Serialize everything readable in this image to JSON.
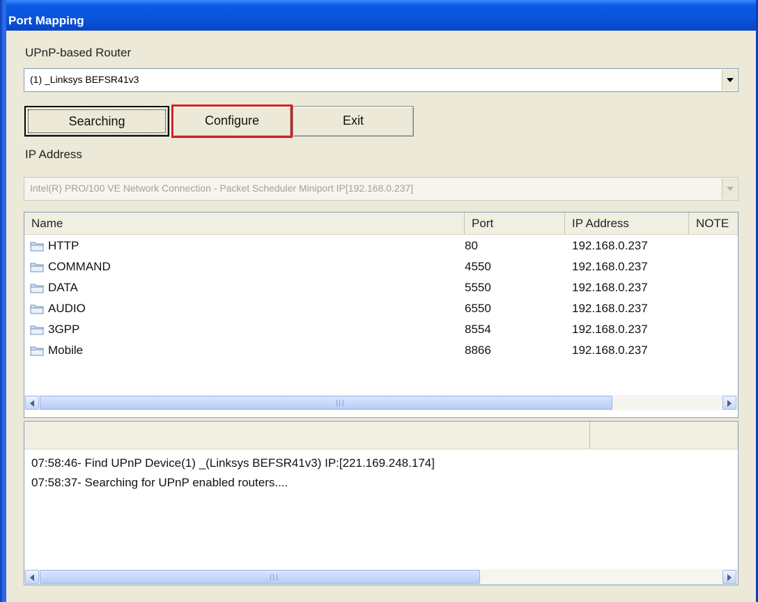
{
  "window": {
    "title": "Port Mapping"
  },
  "router": {
    "label": "UPnP-based Router",
    "selected": "(1) _Linksys BEFSR41v3"
  },
  "buttons": {
    "searching": "Searching",
    "configure": "Configure",
    "exit": "Exit"
  },
  "ip": {
    "label": "IP Address",
    "selected": "Intel(R) PRO/100 VE Network Connection - Packet Scheduler Miniport  IP[192.168.0.237]"
  },
  "mapping_table": {
    "columns": [
      "Name",
      "Port",
      "IP Address",
      "NOTE"
    ],
    "rows": [
      {
        "name": "HTTP",
        "port": "80",
        "ip": "192.168.0.237",
        "icon": "folder-icon"
      },
      {
        "name": "COMMAND",
        "port": "4550",
        "ip": "192.168.0.237",
        "icon": "folder-icon"
      },
      {
        "name": "DATA",
        "port": "5550",
        "ip": "192.168.0.237",
        "icon": "folder-icon"
      },
      {
        "name": "AUDIO",
        "port": "6550",
        "ip": "192.168.0.237",
        "icon": "folder-icon"
      },
      {
        "name": "3GPP",
        "port": "8554",
        "ip": "192.168.0.237",
        "icon": "folder-icon"
      },
      {
        "name": "Mobile",
        "port": "8866",
        "ip": "192.168.0.237",
        "icon": "folder-icon"
      }
    ]
  },
  "log": {
    "lines": [
      "07:58:46- Find UPnP Device(1) _(Linksys BEFSR41v3) IP:[221.169.248.174]",
      "07:58:37- Searching for UPnP enabled routers...."
    ]
  },
  "colors": {
    "titlebar": "#0a55df",
    "highlight": "#d42020",
    "face": "#ece9d8"
  }
}
